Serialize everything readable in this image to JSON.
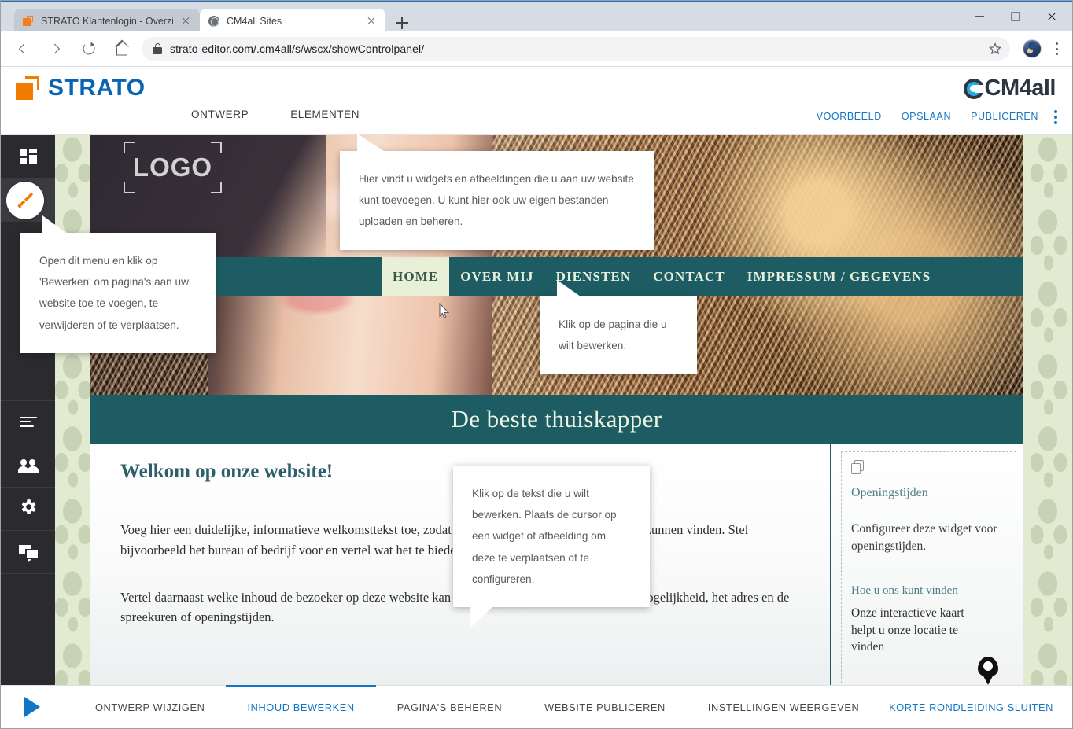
{
  "browser": {
    "tabs": [
      {
        "title": "STRATO Klantenlogin - Overzicht",
        "favicon": "strato-icon",
        "active": false
      },
      {
        "title": "CM4all Sites",
        "favicon": "globe-icon",
        "active": true
      }
    ],
    "newtab_label": "+",
    "url": "strato-editor.com/.cm4all/s/wscx/showControlpanel/",
    "window_controls": {
      "minimize": "minimize-icon",
      "maximize": "maximize-icon",
      "close": "close-icon"
    },
    "toolbar_icons": [
      "back-icon",
      "forward-icon",
      "reload-icon",
      "home-icon",
      "lock-icon",
      "star-icon",
      "avatar",
      "kebab-menu-icon"
    ]
  },
  "app_header": {
    "brand": "STRATO",
    "product": "CM4all",
    "nav": [
      {
        "label": "ONTWERP"
      },
      {
        "label": "ELEMENTEN"
      }
    ],
    "actions": [
      {
        "label": "VOORBEELD"
      },
      {
        "label": "OPSLAAN"
      },
      {
        "label": "PUBLICEREN"
      }
    ],
    "overflow_icon": "kebab-menu-icon"
  },
  "sidebar": {
    "items": [
      {
        "icon": "layout-grid-icon",
        "name": "sidebar-item-layout",
        "active": false
      },
      {
        "icon": "paintbrush-icon",
        "name": "sidebar-item-design",
        "active": true
      },
      {
        "icon": "list-lines-icon",
        "name": "sidebar-item-pages",
        "active": false
      },
      {
        "icon": "people-icon",
        "name": "sidebar-item-users",
        "active": false
      },
      {
        "icon": "gear-icon",
        "name": "sidebar-item-settings",
        "active": false
      },
      {
        "icon": "chat-icon",
        "name": "sidebar-item-support",
        "active": false
      }
    ]
  },
  "site": {
    "logo_placeholder": "LOGO",
    "nav": [
      {
        "label": "HOME",
        "active": true
      },
      {
        "label": "OVER MIJ",
        "active": false
      },
      {
        "label": "DIENSTEN",
        "active": false
      },
      {
        "label": "CONTACT",
        "active": false
      },
      {
        "label": "IMPRESSUM / GEGEVENS",
        "active": false
      }
    ],
    "title_band": "De beste thuiskapper",
    "welcome_heading": "Welkom op onze website!",
    "paragraph_1": "Voeg hier een duidelijke, informatieve welkomsttekst toe, zodat bezoekers meteen weten wat ze hier kunnen vinden. Stel bijvoorbeeld het bureau of bedrijf voor en vertel wat het te bieden aanbiedt.",
    "paragraph_2": "Vertel daarnaast welke inhoud de bezoeker op deze website kan verwachten. Noem ook een contactmogelijkheid, het adres en de spreekuren of openingstijden.",
    "widget": {
      "icon": "copy-widget-icon",
      "heading": "Openingstijden",
      "text": "Configureer deze widget voor openingstijden.",
      "heading2": "Hoe u ons kunt vinden",
      "text2": "Onze interactieve kaart helpt u onze locatie te vinden",
      "map_icon": "map-pin-icon"
    }
  },
  "callouts": {
    "menu": "Open dit menu en klik op 'Bewerken' om pagina's aan uw website toe te voegen, te verwijderen of te verplaatsen.",
    "elements": "Hier vindt u widgets en afbeeldingen die u aan uw website kunt toevoegen. U kunt hier ook uw eigen bestanden uploaden en beheren.",
    "page": "Klik op de pagina die u wilt bewerken.",
    "text": "Klik op de tekst die u wilt bewerken. Plaats de cursor op een widget of afbeelding om deze te verplaatsen of te configureren."
  },
  "tourbar": {
    "play_icon": "play-icon",
    "items": [
      {
        "label": "ONTWERP WIJZIGEN",
        "selected": false
      },
      {
        "label": "INHOUD BEWERKEN",
        "selected": true
      },
      {
        "label": "PAGINA'S BEHEREN",
        "selected": false
      },
      {
        "label": "WEBSITE PUBLICEREN",
        "selected": false
      },
      {
        "label": "INSTELLINGEN WEERGEVEN",
        "selected": false
      }
    ],
    "close_label": "KORTE RONDLEIDING SLUITEN"
  },
  "colors": {
    "accent_blue": "#1276c4",
    "strato_orange": "#f07d00",
    "strato_blue": "#0a64b4",
    "site_teal": "#1d5c63",
    "sidebar_dark": "#2b2b2f"
  }
}
